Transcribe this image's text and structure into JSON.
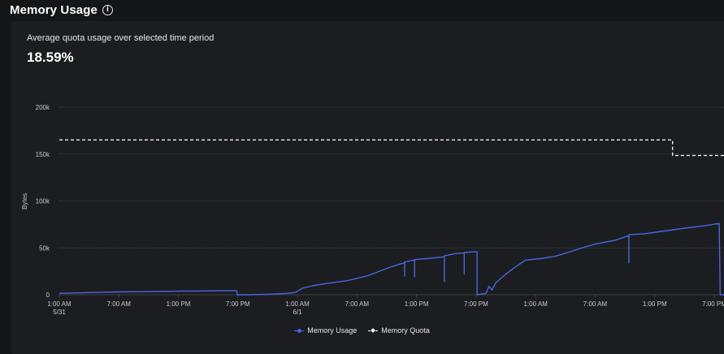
{
  "panel": {
    "title": "Memory Usage",
    "info_icon": "info-icon",
    "subtitle": "Average quota usage over selected time period",
    "value": "18.59%"
  },
  "colors": {
    "background": "#141517",
    "card": "#1c1d20",
    "usage": "#4766e0",
    "quota": "#ffffff",
    "grid": "#4a4b50"
  },
  "chart_data": {
    "type": "line",
    "ylabel": "Bytes",
    "ylim": [
      0,
      200000
    ],
    "y_ticks": [
      {
        "value": 0,
        "label": "0"
      },
      {
        "value": 50000,
        "label": "50k"
      },
      {
        "value": 100000,
        "label": "100k"
      },
      {
        "value": 150000,
        "label": "150k"
      },
      {
        "value": 200000,
        "label": "200k"
      }
    ],
    "x_unit": "hours from 5/31 1:00 AM",
    "xlim": [
      0,
      66
    ],
    "x_ticks": [
      {
        "value": 0,
        "label": "1:00 AM",
        "sublabel": "5/31"
      },
      {
        "value": 6,
        "label": "7:00 AM",
        "sublabel": ""
      },
      {
        "value": 12,
        "label": "1:00 PM",
        "sublabel": ""
      },
      {
        "value": 18,
        "label": "7:00 PM",
        "sublabel": ""
      },
      {
        "value": 24,
        "label": "1:00 AM",
        "sublabel": "6/1"
      },
      {
        "value": 30,
        "label": "7:00 AM",
        "sublabel": ""
      },
      {
        "value": 36,
        "label": "1:00 PM",
        "sublabel": ""
      },
      {
        "value": 42,
        "label": "7:00 PM",
        "sublabel": ""
      },
      {
        "value": 48,
        "label": "1:00 AM",
        "sublabel": ""
      },
      {
        "value": 54,
        "label": "7:00 AM",
        "sublabel": ""
      },
      {
        "value": 60,
        "label": "1:00 PM",
        "sublabel": ""
      },
      {
        "value": 66,
        "label": "7:00 PM",
        "sublabel": ""
      }
    ],
    "grid": true,
    "legend_position": "bottom",
    "series": [
      {
        "name": "Memory Usage",
        "style": "solid",
        "points": [
          [
            0,
            1500
          ],
          [
            2,
            2000
          ],
          [
            4,
            2500
          ],
          [
            6,
            3000
          ],
          [
            8,
            3200
          ],
          [
            10,
            3500
          ],
          [
            12,
            3800
          ],
          [
            14,
            4000
          ],
          [
            16,
            4200
          ],
          [
            17.9,
            4200
          ],
          [
            17.9,
            0
          ],
          [
            19,
            0
          ],
          [
            21,
            500
          ],
          [
            23,
            1500
          ],
          [
            23.8,
            2500
          ],
          [
            24.5,
            7000
          ],
          [
            25.5,
            9500
          ],
          [
            27,
            12000
          ],
          [
            29,
            15000
          ],
          [
            31,
            20000
          ],
          [
            32.5,
            26000
          ],
          [
            33.5,
            30000
          ],
          [
            34.4,
            33000
          ],
          [
            34.8,
            34000
          ],
          [
            34.8,
            20000
          ],
          [
            34.8,
            35000
          ],
          [
            35.5,
            36500
          ],
          [
            35.8,
            37000
          ],
          [
            35.8,
            19000
          ],
          [
            35.8,
            37500
          ],
          [
            37.5,
            39000
          ],
          [
            38.8,
            40500
          ],
          [
            38.8,
            14000
          ],
          [
            38.8,
            41500
          ],
          [
            40,
            44000
          ],
          [
            40.8,
            44500
          ],
          [
            40.8,
            22000
          ],
          [
            40.8,
            45000
          ],
          [
            42,
            46000
          ],
          [
            42.1,
            46000
          ],
          [
            42.1,
            0
          ],
          [
            43,
            1500
          ],
          [
            43.3,
            9000
          ],
          [
            43.6,
            5000
          ],
          [
            44,
            13000
          ],
          [
            45,
            22000
          ],
          [
            46,
            30000
          ],
          [
            47,
            37000
          ],
          [
            48.5,
            38500
          ],
          [
            50,
            41000
          ],
          [
            51.5,
            46000
          ],
          [
            53,
            51000
          ],
          [
            54,
            54000
          ],
          [
            56,
            58000
          ],
          [
            57.4,
            63000
          ],
          [
            57.4,
            34000
          ],
          [
            57.4,
            64000
          ],
          [
            59,
            65000
          ],
          [
            61,
            68000
          ],
          [
            63,
            71000
          ],
          [
            65,
            73500
          ],
          [
            66.5,
            76000
          ],
          [
            66.6,
            0
          ],
          [
            67,
            0
          ],
          [
            67.4,
            3000
          ],
          [
            67.8,
            6000
          ],
          [
            67.8,
            15000
          ]
        ]
      },
      {
        "name": "Memory Quota",
        "style": "dashed",
        "points": [
          [
            0,
            165000
          ],
          [
            61.8,
            165000
          ],
          [
            61.8,
            148500
          ],
          [
            67.8,
            148500
          ]
        ]
      }
    ]
  },
  "legend": {
    "usage_label": "Memory Usage",
    "quota_label": "Memory Quota"
  }
}
